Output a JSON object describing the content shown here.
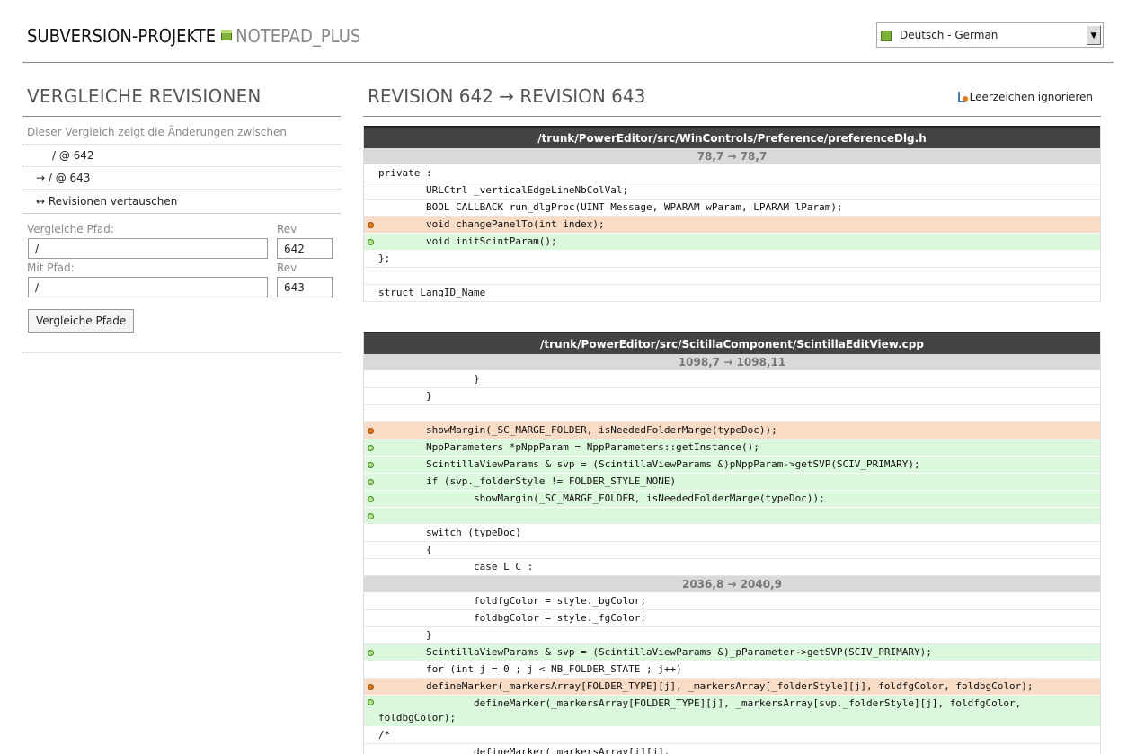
{
  "header": {
    "title": "SUBVERSION-PROJEKTE",
    "project": "NOTEPAD_PLUS",
    "language": "Deutsch - German"
  },
  "left": {
    "heading": "VERGLEICHE REVISIONEN",
    "description": "Dieser Vergleich zeigt die Änderungen zwischen",
    "from_rev": "/ @ 642",
    "to_rev": "→ / @ 643",
    "swap": "↔ Revisionen vertauschen",
    "form": {
      "path1_label": "Vergleiche Pfad:",
      "path1_value": "/",
      "rev1_label": "Rev",
      "rev1_value": "642",
      "path2_label": "Mit Pfad:",
      "path2_value": "/",
      "rev2_label": "Rev",
      "rev2_value": "643",
      "button": "Vergleiche Pfade"
    }
  },
  "right": {
    "heading": "REVISION 642 → REVISION 643",
    "ignore_ws": "Leerzeichen ignorieren"
  },
  "files": [
    {
      "path": "/trunk/PowerEditor/src/WinControls/Preference/preferenceDlg.h",
      "rows": [
        {
          "kind": "hunk",
          "text": "78,7 → 78,7"
        },
        {
          "kind": "ctx",
          "text": "private :"
        },
        {
          "kind": "ctx",
          "text": "        URLCtrl _verticalEdgeLineNbColVal;"
        },
        {
          "kind": "ctx",
          "text": "        BOOL CALLBACK run_dlgProc(UINT Message, WPARAM wParam, LPARAM lParam);"
        },
        {
          "kind": "del",
          "text": "        void changePanelTo(int index);"
        },
        {
          "kind": "add",
          "text": "        void initScintParam();"
        },
        {
          "kind": "ctx",
          "text": "};"
        },
        {
          "kind": "ctx",
          "text": ""
        },
        {
          "kind": "ctx",
          "text": "struct LangID_Name"
        }
      ]
    },
    {
      "path": "/trunk/PowerEditor/src/ScitillaComponent/ScintillaEditView.cpp",
      "rows": [
        {
          "kind": "hunk",
          "text": "1098,7 → 1098,11"
        },
        {
          "kind": "ctx",
          "text": "                }"
        },
        {
          "kind": "ctx",
          "text": "        }"
        },
        {
          "kind": "ctx",
          "text": ""
        },
        {
          "kind": "del",
          "text": "        showMargin(_SC_MARGE_FOLDER, isNeededFolderMarge(typeDoc));"
        },
        {
          "kind": "add",
          "text": "        NppParameters *pNppParam = NppParameters::getInstance();"
        },
        {
          "kind": "add",
          "text": "        ScintillaViewParams & svp = (ScintillaViewParams &)pNppParam->getSVP(SCIV_PRIMARY);"
        },
        {
          "kind": "add",
          "text": "        if (svp._folderStyle != FOLDER_STYLE_NONE)"
        },
        {
          "kind": "add",
          "text": "                showMargin(_SC_MARGE_FOLDER, isNeededFolderMarge(typeDoc));"
        },
        {
          "kind": "add",
          "text": ""
        },
        {
          "kind": "ctx",
          "text": "        switch (typeDoc)"
        },
        {
          "kind": "ctx",
          "text": "        {"
        },
        {
          "kind": "ctx",
          "text": "                case L_C :"
        },
        {
          "kind": "hunk",
          "text": "2036,8 → 2040,9"
        },
        {
          "kind": "ctx",
          "text": "                foldfgColor = style._bgColor;"
        },
        {
          "kind": "ctx",
          "text": "                foldbgColor = style._fgColor;"
        },
        {
          "kind": "ctx",
          "text": "        }"
        },
        {
          "kind": "add",
          "text": "        ScintillaViewParams & svp = (ScintillaViewParams &)_pParameter->getSVP(SCIV_PRIMARY);"
        },
        {
          "kind": "ctx",
          "text": "        for (int j = 0 ; j < NB_FOLDER_STATE ; j++)"
        },
        {
          "kind": "del",
          "text": "        defineMarker(_markersArray[FOLDER_TYPE][j], _markersArray[_folderStyle][j], foldfgColor, foldbgColor);"
        },
        {
          "kind": "add",
          "text": "                defineMarker(_markersArray[FOLDER_TYPE][j], _markersArray[svp._folderStyle][j], foldfgColor,\nfoldbgColor);",
          "tall": true
        },
        {
          "kind": "ctx",
          "text": "/*"
        },
        {
          "kind": "ctx",
          "text": "                defineMarker(_markersArray[i][j],"
        }
      ]
    }
  ]
}
